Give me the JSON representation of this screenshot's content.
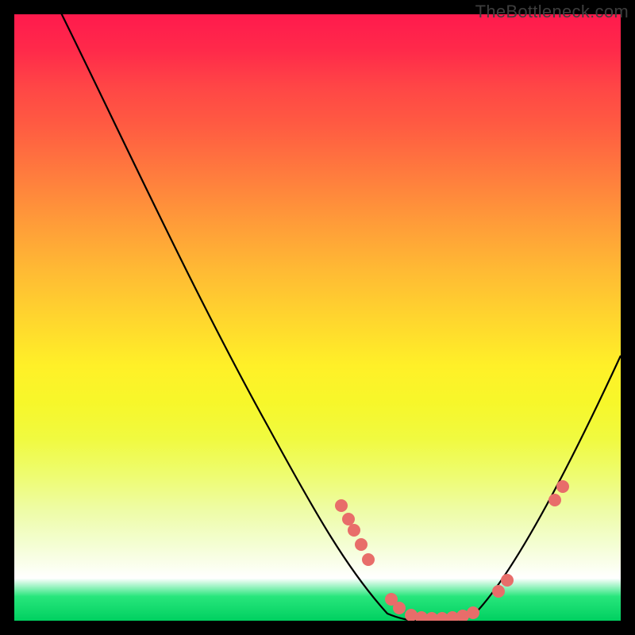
{
  "watermark": "TheBottleneck.com",
  "chart_data": {
    "type": "line",
    "title": "",
    "xlabel": "",
    "ylabel": "",
    "xlim": [
      0,
      100
    ],
    "ylim": [
      0,
      100
    ],
    "x": [
      0,
      6,
      12,
      18,
      24,
      30,
      36,
      42,
      48,
      54,
      58,
      62,
      66,
      70,
      74,
      78,
      82,
      86,
      90,
      94,
      100
    ],
    "values": [
      112,
      100,
      88,
      77,
      66,
      55,
      45,
      36,
      28,
      19,
      11,
      5,
      1,
      0,
      0,
      2,
      9,
      20,
      33,
      40,
      48
    ],
    "markers": {
      "x": [
        54,
        55,
        56,
        57.5,
        59,
        63,
        64.5,
        66,
        68,
        70,
        72,
        74,
        76,
        78,
        80,
        88,
        89.5
      ],
      "y": [
        19,
        17,
        15,
        12,
        10,
        3.5,
        2,
        1,
        0.2,
        0,
        0,
        0,
        1,
        2,
        5.5,
        27,
        30
      ],
      "color": "#e86d6a"
    }
  }
}
